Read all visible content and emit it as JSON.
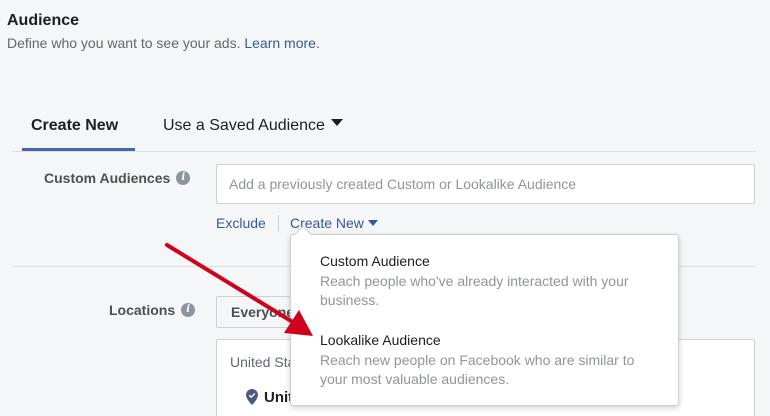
{
  "header": {
    "title": "Audience",
    "subtitle": "Define who you want to see your ads.",
    "learn_more": "Learn more."
  },
  "tabs": [
    {
      "label": "Create New",
      "active": true
    },
    {
      "label": "Use a Saved Audience",
      "active": false
    }
  ],
  "custom_audiences": {
    "label": "Custom Audiences",
    "placeholder": "Add a previously created Custom or Lookalike Audience",
    "exclude_label": "Exclude",
    "create_new_label": "Create New"
  },
  "locations": {
    "label": "Locations",
    "selector_value": "Everyone",
    "box_text": "United States",
    "item": "United States"
  },
  "dropdown": {
    "options": [
      {
        "title": "Custom Audience",
        "description": "Reach people who've already interacted with your business."
      },
      {
        "title": "Lookalike Audience",
        "description": "Reach new people on Facebook who are similar to your most valuable audiences."
      }
    ]
  },
  "colors": {
    "accent": "#4267b2",
    "link": "#385898",
    "annotation_arrow": "#d0021b"
  },
  "icons": {
    "info": "info-icon",
    "caret": "caret-down-icon",
    "pin": "location-pin-icon"
  }
}
